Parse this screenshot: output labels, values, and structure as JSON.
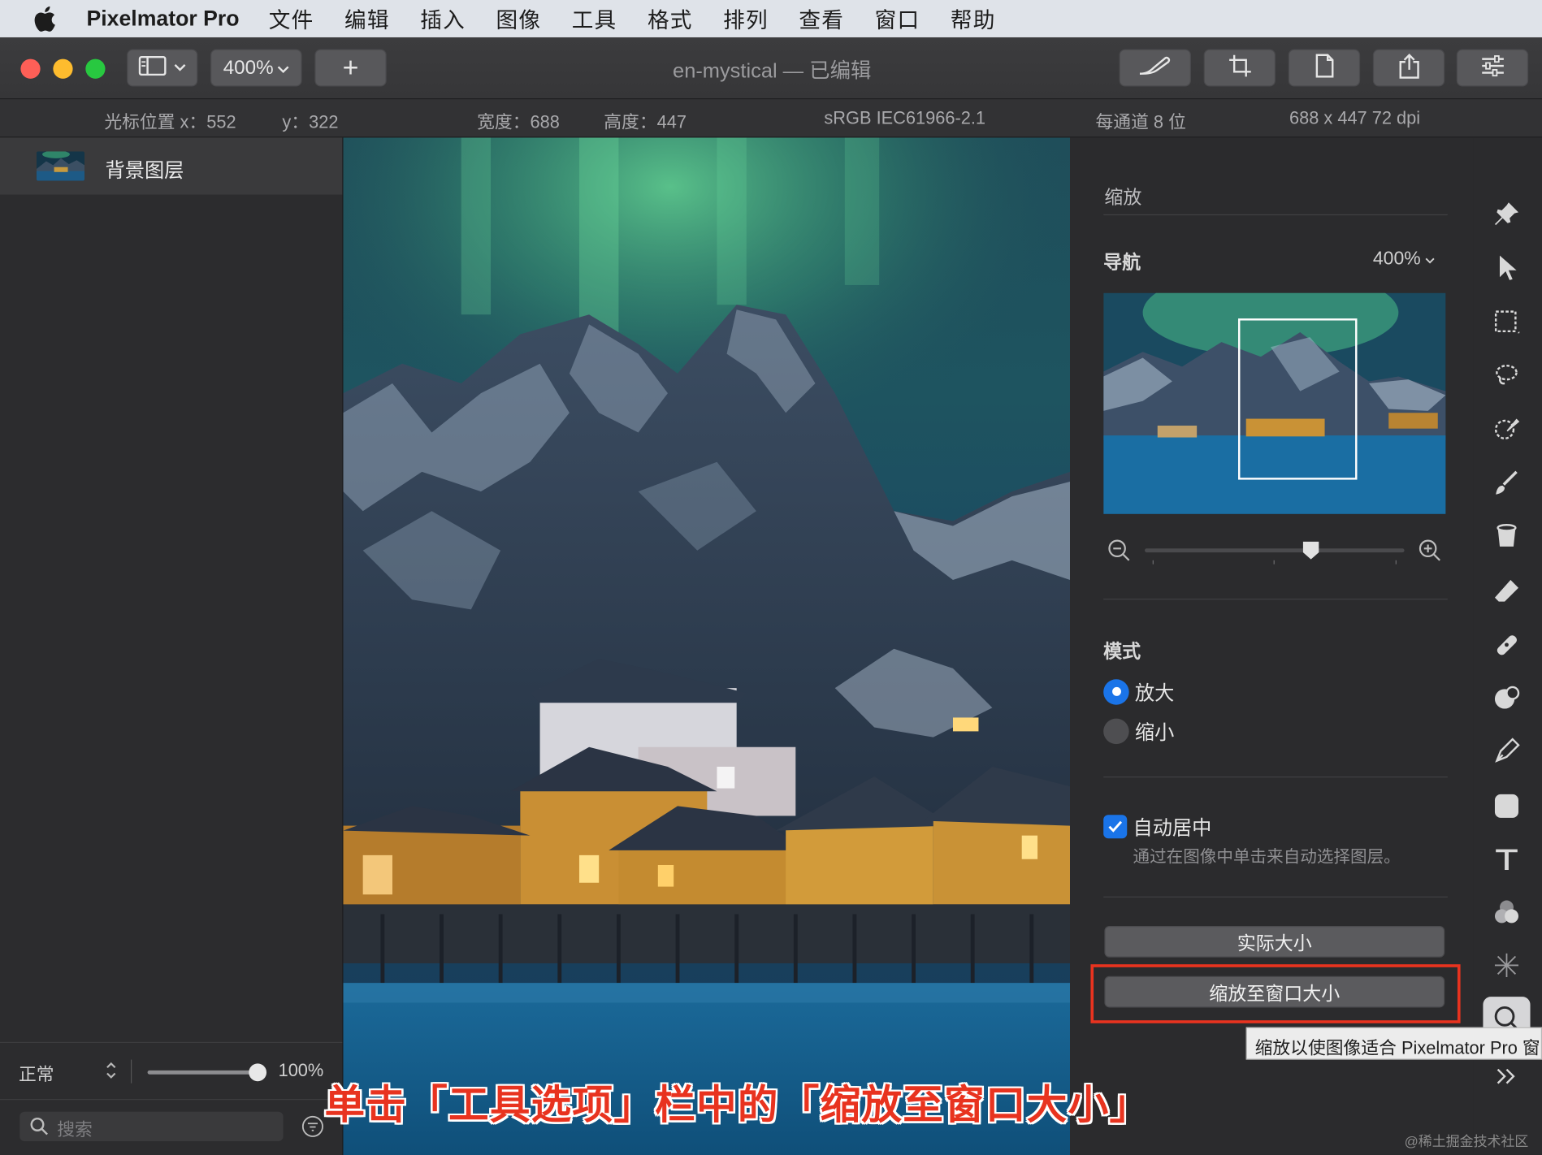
{
  "menubar": {
    "app_name": "Pixelmator Pro",
    "items": [
      "文件",
      "编辑",
      "插入",
      "图像",
      "工具",
      "格式",
      "排列",
      "查看",
      "窗口",
      "帮助"
    ]
  },
  "toolbar": {
    "zoom_label": "400%",
    "add_label": "+",
    "window_title": "en-mystical — 已编辑"
  },
  "infobar": {
    "cursor_x": "光标位置 x：552",
    "cursor_y": "y：322",
    "width": "宽度：688",
    "height": "高度：447",
    "color_profile": "sRGB IEC61966-2.1",
    "bit_depth": "每通道 8 位",
    "dimensions": "688 x 447 72 dpi"
  },
  "layers": {
    "items": [
      {
        "name": "背景图层"
      }
    ],
    "blend_mode": "正常",
    "opacity": "100%",
    "opacity_level": 1.0,
    "search_placeholder": "搜索"
  },
  "zoom_panel": {
    "title": "缩放",
    "navigation_label": "导航",
    "zoom_value": "400%",
    "slider_level": 0.64,
    "mode_label": "模式",
    "mode_options": [
      {
        "label": "放大",
        "selected": true
      },
      {
        "label": "缩小",
        "selected": false
      }
    ],
    "auto_center_label": "自动居中",
    "auto_center_checked": true,
    "auto_center_hint": "通过在图像中单击来自动选择图层。",
    "actual_size_button": "实际大小",
    "fit_window_button": "缩放至窗口大小"
  },
  "tooltip": "缩放以使图像适合 Pixelmator Pro 窗",
  "caption": "单击「工具选项」栏中的「缩放至窗口大小」",
  "watermark": "@稀土掘金技术社区",
  "colors": {
    "accent_blue": "#1a74e8",
    "highlight_red": "#e8331f",
    "close": "#fe5f57",
    "minimize": "#febc2e",
    "maximize": "#28c840"
  },
  "tools": [
    "pin-icon",
    "pointer-icon",
    "rect-select-icon",
    "lasso-icon",
    "color-select-icon",
    "paint-brush-icon",
    "fill-bucket-icon",
    "eraser-icon",
    "repair-icon",
    "clone-icon",
    "pen-icon",
    "shape-icon",
    "type-icon",
    "color-adjust-icon",
    "effects-icon",
    "zoom-icon"
  ]
}
